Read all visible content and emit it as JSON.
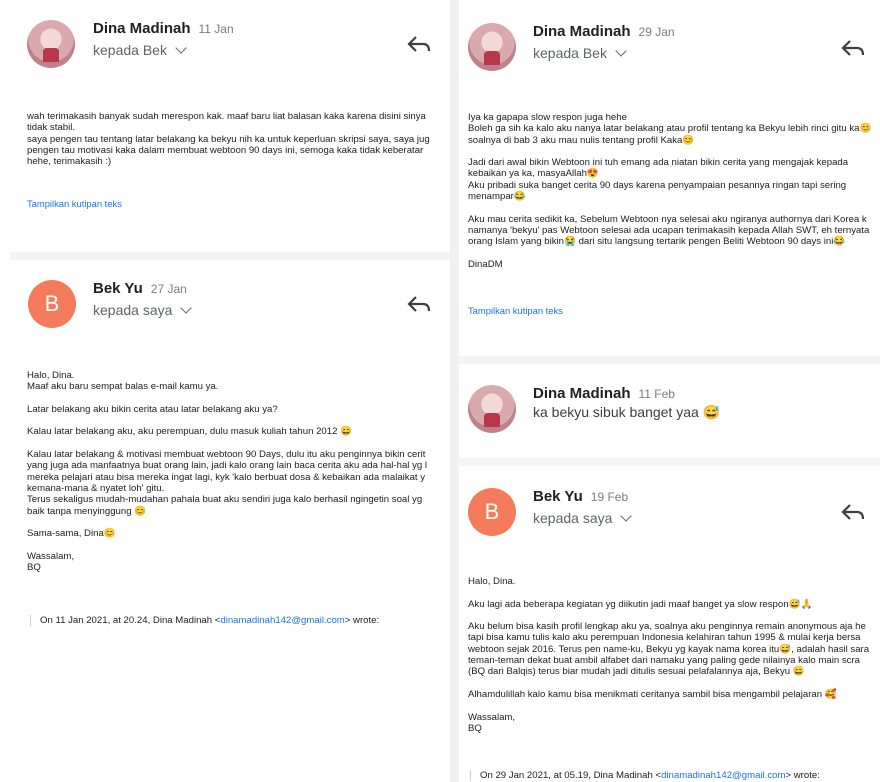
{
  "emails": [
    {
      "sender": "Dina Madinah",
      "date": "11 Jan",
      "recipient": "kepada Bek",
      "body": "wah terimakasih banyak sudah merespon kak. maaf baru liat balasan kaka karena disini sinya\ntidak stabil.\nsaya pengen tau tentang latar belakang ka bekyu nih ka untuk keperluan skripsi saya, saya jug\npengen tau motivasi kaka dalam membuat webtoon 90 days ini, semoga kaka tidak keberatar\nhehe, terimakasih :)",
      "quote_toggle": "Tampilkan kutipan teks"
    },
    {
      "sender": "Bek Yu",
      "avatar_letter": "B",
      "date": "27 Jan",
      "recipient": "kepada saya",
      "body": "Halo, Dina.\nMaaf aku baru sempat balas e-mail kamu ya.\n\nLatar belakang aku bikin cerita atau latar belakang aku ya?\n\nKalau latar belakang aku, aku perempuan, dulu masuk kuliah tahun 2012 😄\n\nKalau latar belakang & motivasi membuat webtoon 90 Days, dulu itu aku penginnya bikin cerit\nyang juga ada manfaatnya buat orang lain, jadi kalo orang lain baca cerita aku ada hal-hal yg l\nmereka pelajari atau bisa mereka ingat lagi, kyk 'kalo berbuat dosa & kebaikan ada malaikat y\nkemana-mana & nyatet loh' gitu.\nTerus sekaligus mudah-mudahan pahala buat aku sendiri juga kalo berhasil ngingetin soal yg\nbaik tanpa menyinggung 😊\n\nSama-sama, Dina😊\n\nWassalam,\nBQ",
      "quote_prefix": "On 11 Jan 2021, at 20.24, Dina Madinah <",
      "quote_email": "dinamadinah142@gmail.com",
      "quote_suffix": "> wrote:"
    },
    {
      "sender": "Dina Madinah",
      "date": "29 Jan",
      "recipient": "kepada Bek",
      "body": "Iya ka gapapa slow respon juga hehe\nBoleh ga sih ka kalo aku nanya latar belakang atau profil tentang ka Bekyu lebih rinci gitu ka😊\nsoalnya di bab 3 aku mau nulis tentang profil Kaka😊\n\nJadi dari awal bikin Webtoon ini tuh emang ada niatan bikin cerita yang mengajak kepada\nkebaikan ya ka, masyaAllah😍\nAku pribadi suka banget cerita 90 days karena penyampaian pesannya ringan tapi sering\nmenampar😂\n\nAku mau cerita sedikit ka, Sebelum Webtoon nya selesai aku ngiranya authornya dari Korea k\nnamanya 'bekyu' pas Webtoon selesai ada ucapan terimakasih kepada Allah SWT, eh ternyata\norang Islam yang bikin😭 dari situ langsung tertarik pengen Beliti Webtoon 90 days ini😂\n\nDinaDM",
      "quote_toggle": "Tampilkan kutipan teks"
    },
    {
      "sender": "Dina Madinah",
      "date": "11 Feb",
      "snippet": "ka bekyu sibuk banget yaa 😅"
    },
    {
      "sender": "Bek Yu",
      "avatar_letter": "B",
      "date": "19 Feb",
      "recipient": "kepada saya",
      "body": "Halo, Dina.\n\nAku lagi ada beberapa kegiatan yg diikutin jadi maaf banget ya slow respon😅🙏\n\nAku belum bisa kasih profil lengkap aku ya, soalnya aku penginnya remain anonymous aja he\ntapi bisa kamu tulis kalo aku perempuan Indonesia kelahiran tahun 1995 & mulai kerja bersa\nwebtoon sejak 2016. Terus pen name-ku, Bekyu yg kayak nama korea itu😅, adalah hasil sara\nteman-teman dekat buat ambil alfabet dari namaku yang paling gede nilainya kalo main scra\n(BQ dari Balqis) terus biar mudah jadi ditulis sesuai pelafalannya aja, Bekyu 😄\n\nAlhamdulillah kalo kamu bisa menikmati ceritanya sambil bisa mengambil pelajaran 🥰\n\nWassalam,\nBQ",
      "quote_prefix": "On 29 Jan 2021, at 05.19, Dina Madinah <",
      "quote_email": "dinamadinah142@gmail.com",
      "quote_suffix": "> wrote:"
    }
  ],
  "icons": {
    "reply": "reply-arrow-icon",
    "expand": "chevron-down-icon"
  },
  "colors": {
    "link": "#1a73e8",
    "avatar_letter_bg": "#f47b5b"
  }
}
